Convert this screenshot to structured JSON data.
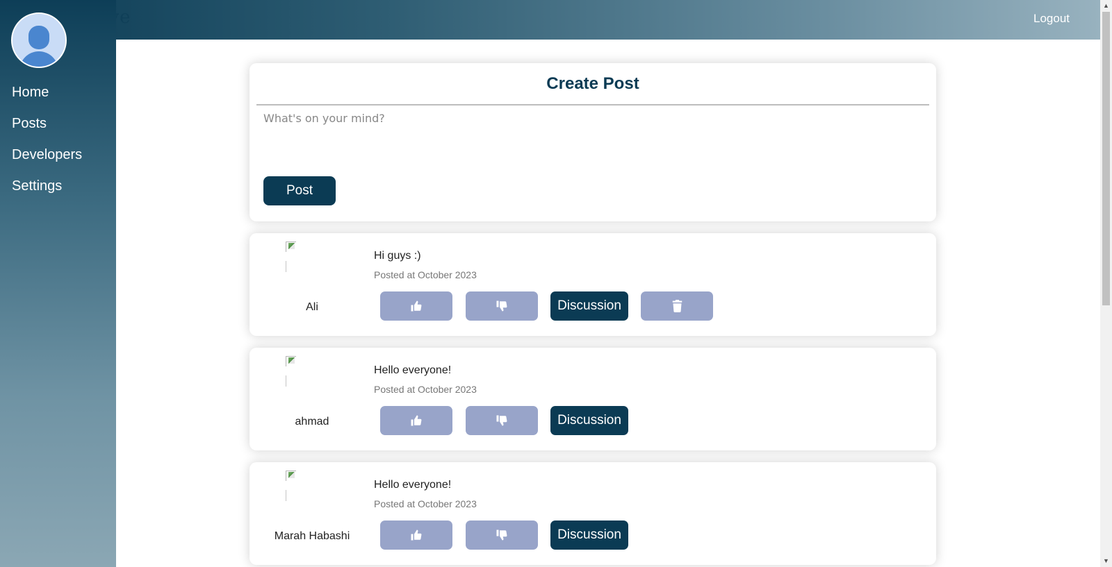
{
  "header": {
    "brand": "Weave",
    "logout_label": "Logout"
  },
  "sidebar": {
    "items": [
      {
        "label": "Home"
      },
      {
        "label": "Posts"
      },
      {
        "label": "Developers"
      },
      {
        "label": "Settings"
      }
    ]
  },
  "create_post": {
    "title": "Create Post",
    "placeholder": "What's on your mind?",
    "value": "",
    "button_label": "Post"
  },
  "posts": [
    {
      "author": "Ali",
      "text": "Hi guys :)",
      "date": "Posted at October 2023",
      "discussion_label": "Discussion",
      "show_delete": true
    },
    {
      "author": "ahmad",
      "text": "Hello everyone!",
      "date": "Posted at October 2023",
      "discussion_label": "Discussion",
      "show_delete": false
    },
    {
      "author": "Marah Habashi",
      "text": "Hello everyone!",
      "date": "Posted at October 2023",
      "discussion_label": "Discussion",
      "show_delete": false
    }
  ],
  "colors": {
    "primary": "#0b3b54",
    "soft_button": "#98a4c9"
  },
  "icons": {
    "like": "thumbs-up-icon",
    "dislike": "thumbs-down-icon",
    "delete": "trash-icon"
  }
}
